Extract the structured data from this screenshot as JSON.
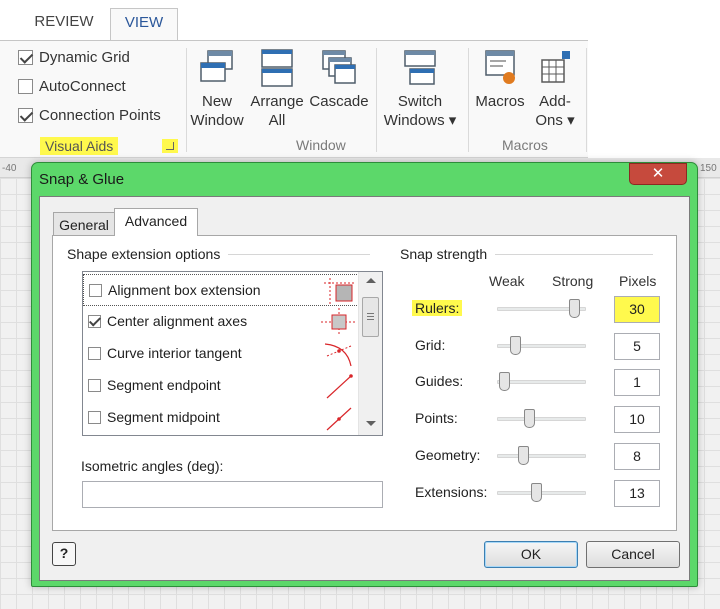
{
  "ribbon": {
    "tabs": {
      "review": "REVIEW",
      "view": "VIEW"
    },
    "visual_aids": {
      "items": [
        {
          "label": "Dynamic Grid",
          "checked": true
        },
        {
          "label": "AutoConnect",
          "checked": false
        },
        {
          "label": "Connection Points",
          "checked": true
        }
      ],
      "group_label": "Visual Aids"
    },
    "window_group": {
      "new_window": [
        "New",
        "Window"
      ],
      "arrange_all": [
        "Arrange",
        "All"
      ],
      "cascade": "Cascade",
      "switch_windows": [
        "Switch",
        "Windows ▾"
      ],
      "group_label": "Window"
    },
    "macros_group": {
      "macros": "Macros",
      "addons": [
        "Add-",
        "Ons ▾"
      ],
      "group_label": "Macros"
    }
  },
  "ruler": {
    "left": "-40",
    "right": "150"
  },
  "dialog": {
    "title": "Snap & Glue",
    "close_glyph": "✕",
    "tabs": {
      "general": "General",
      "advanced": "Advanced"
    },
    "shape_extension": {
      "heading": "Shape extension options",
      "items": [
        {
          "label": "Alignment box extension",
          "checked": false,
          "icon": "alignment-box-icon"
        },
        {
          "label": "Center alignment axes",
          "checked": true,
          "icon": "center-axes-icon"
        },
        {
          "label": "Curve interior tangent",
          "checked": false,
          "icon": "curve-tangent-icon"
        },
        {
          "label": "Segment endpoint",
          "checked": false,
          "icon": "segment-endpoint-icon"
        },
        {
          "label": "Segment midpoint",
          "checked": false,
          "icon": "segment-midpoint-icon"
        }
      ]
    },
    "isometric": {
      "label": "Isometric angles (deg):",
      "value": ""
    },
    "snap_strength": {
      "heading": "Snap strength",
      "col_weak": "Weak",
      "col_strong": "Strong",
      "col_pixels": "Pixels",
      "rows": [
        {
          "label": "Rulers:",
          "pixels": "30",
          "level": 0.92,
          "highlight": true
        },
        {
          "label": "Grid:",
          "pixels": "5",
          "level": 0.17,
          "highlight": false
        },
        {
          "label": "Guides:",
          "pixels": "1",
          "level": 0.03,
          "highlight": false
        },
        {
          "label": "Points:",
          "pixels": "10",
          "level": 0.34,
          "highlight": false
        },
        {
          "label": "Geometry:",
          "pixels": "8",
          "level": 0.27,
          "highlight": false
        },
        {
          "label": "Extensions:",
          "pixels": "13",
          "level": 0.44,
          "highlight": false
        }
      ]
    },
    "help_glyph": "?",
    "ok": "OK",
    "cancel": "Cancel"
  },
  "colors": {
    "dialog_frame": "#5cd86a",
    "highlight": "#fff94d",
    "close_button": "#c64a3d",
    "accent_red": "#d9262a"
  }
}
